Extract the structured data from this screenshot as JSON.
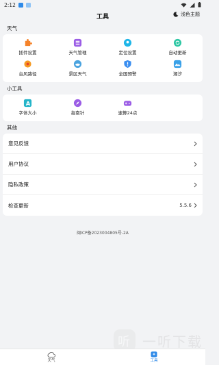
{
  "status_bar": {
    "time": "2:12"
  },
  "header": {
    "title": "工具",
    "theme_label": "浅色主题"
  },
  "sections": {
    "weather": {
      "label": "天气",
      "items": [
        {
          "label": "插件设置",
          "icon": "plugin-icon",
          "color": "#f5832a"
        },
        {
          "label": "天气管理",
          "icon": "weather-manage-icon",
          "color": "#9b5de5"
        },
        {
          "label": "定位设置",
          "icon": "location-icon",
          "color": "#1fb6e8"
        },
        {
          "label": "自动更新",
          "icon": "auto-update-icon",
          "color": "#2ec7a4"
        },
        {
          "label": "台风路径",
          "icon": "typhoon-icon",
          "color": "#f59a23"
        },
        {
          "label": "景区天气",
          "icon": "scenic-weather-icon",
          "color": "#4aa3df"
        },
        {
          "label": "全国预警",
          "icon": "warning-icon",
          "color": "#3a8ef0"
        },
        {
          "label": "潮汐",
          "icon": "tide-icon",
          "color": "#3aa1e8"
        }
      ]
    },
    "tools": {
      "label": "小工具",
      "items": [
        {
          "label": "字体大小",
          "icon": "font-size-icon",
          "color": "#25b5c9"
        },
        {
          "label": "指南针",
          "icon": "compass-icon",
          "color": "#9b5de5"
        },
        {
          "label": "速算24点",
          "icon": "game-icon",
          "color": "#9b5de5"
        }
      ]
    },
    "other": {
      "label": "其他",
      "rows": [
        {
          "label": "意见反馈",
          "value": ""
        },
        {
          "label": "用户协议",
          "value": ""
        },
        {
          "label": "隐私政策",
          "value": ""
        },
        {
          "label": "检查更新",
          "value": "5.5.6"
        }
      ]
    }
  },
  "icp": "闽ICP备2023004805号-2A",
  "bottom_nav": [
    {
      "label": "天气",
      "icon": "cloud-icon",
      "active": false
    },
    {
      "label": "工具",
      "icon": "tools-icon",
      "active": true
    }
  ],
  "watermark": {
    "text": "一听下载"
  },
  "colors": {
    "accent": "#2f8ae8"
  }
}
